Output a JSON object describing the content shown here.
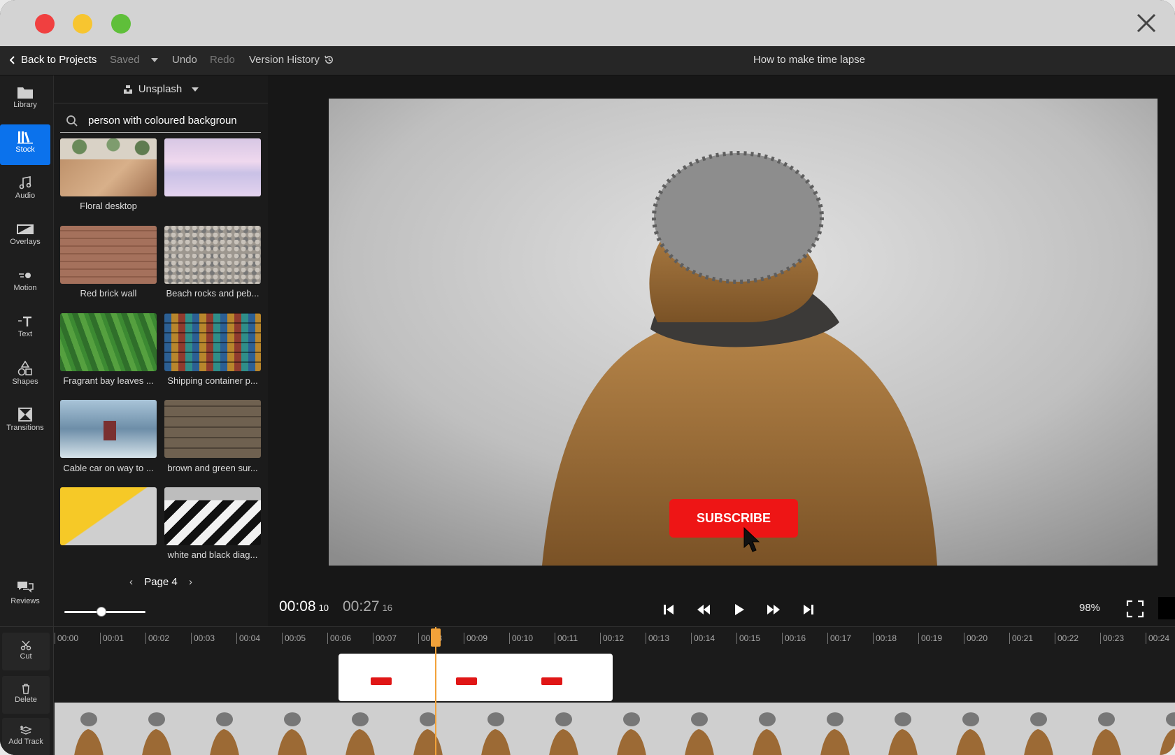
{
  "window": {
    "close_label": "Close"
  },
  "topbar": {
    "back_label": "Back to Projects",
    "saved_label": "Saved",
    "undo_label": "Undo",
    "redo_label": "Redo",
    "version_history_label": "Version History",
    "project_title": "How to make time lapse"
  },
  "leftnav": {
    "items": [
      {
        "label": "Library",
        "icon": "folder-icon"
      },
      {
        "label": "Stock",
        "icon": "stock-icon",
        "active": true
      },
      {
        "label": "Audio",
        "icon": "music-note-icon"
      },
      {
        "label": "Overlays",
        "icon": "overlay-icon"
      },
      {
        "label": "Motion",
        "icon": "motion-icon"
      },
      {
        "label": "Text",
        "icon": "text-icon"
      },
      {
        "label": "Shapes",
        "icon": "shapes-icon"
      },
      {
        "label": "Transitions",
        "icon": "transitions-icon"
      }
    ],
    "reviews_label": "Reviews"
  },
  "stock": {
    "source_label": "Unsplash",
    "search_value": "person with coloured backgroun",
    "results": [
      {
        "label": "Floral desktop"
      },
      {
        "label": ""
      },
      {
        "label": "Red brick wall"
      },
      {
        "label": "Beach rocks and peb..."
      },
      {
        "label": "Fragrant bay leaves ..."
      },
      {
        "label": "Shipping container p..."
      },
      {
        "label": "Cable car on way to ..."
      },
      {
        "label": "brown and green sur..."
      },
      {
        "label": ""
      },
      {
        "label": "white and black diag..."
      }
    ],
    "page_label": "Page 4",
    "thumbnail_zoom": 0.45
  },
  "preview": {
    "overlay_text": "SUBSCRIBE",
    "current_time": "00:08",
    "current_frame": "10",
    "duration": "00:27",
    "duration_frame": "16",
    "zoom": "98%"
  },
  "timeline": {
    "tools": [
      {
        "label": "Cut",
        "icon": "scissors-icon"
      },
      {
        "label": "Delete",
        "icon": "trash-icon"
      },
      {
        "label": "Add Track",
        "icon": "add-track-icon"
      }
    ],
    "ticks": [
      "00:00",
      "00:01",
      "00:02",
      "00:03",
      "00:04",
      "00:05",
      "00:06",
      "00:07",
      "00:08",
      "00:09",
      "00:10",
      "00:11",
      "00:12",
      "00:13",
      "00:14",
      "00:15",
      "00:16",
      "00:17",
      "00:18",
      "00:19",
      "00:20",
      "00:21",
      "00:22",
      "00:23",
      "00:24"
    ]
  },
  "colors": {
    "accent": "#0b72ec",
    "playhead": "#f2a23a",
    "subscribe": "#ee1515"
  }
}
